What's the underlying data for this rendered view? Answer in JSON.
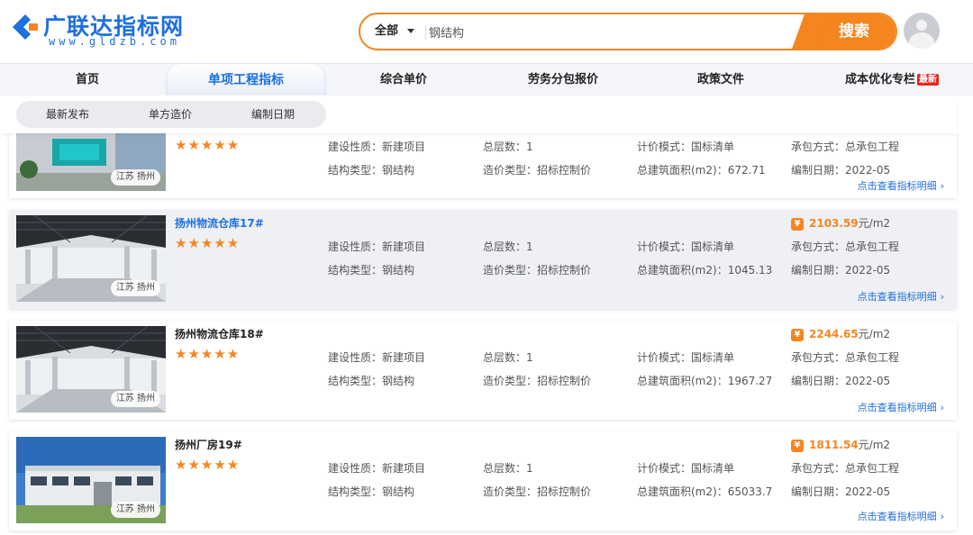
{
  "header": {
    "logo_text": "广联达指标网",
    "logo_sub": "www.gldzb.com",
    "search_scope": "全部",
    "search_value": "钢结构",
    "search_button": "搜索"
  },
  "nav": {
    "items": [
      {
        "label": "首页"
      },
      {
        "label": "单项工程指标"
      },
      {
        "label": "综合单价"
      },
      {
        "label": "劳务分包报价"
      },
      {
        "label": "政策文件"
      },
      {
        "label": "成本优化专栏",
        "badge": "最新"
      }
    ]
  },
  "subnav": {
    "items": [
      {
        "label": "最新发布"
      },
      {
        "label": "单方造价"
      },
      {
        "label": "编制日期"
      }
    ]
  },
  "cards": [
    {
      "title": "",
      "stars": "★★★★★",
      "location": "江苏 扬州",
      "price_amount": "",
      "price_unit": "",
      "nature": "建设性质：新建项目",
      "structure": "结构类型：钢结构",
      "floors": "总层数：1",
      "cost_type": "造价类型：招标控制价",
      "pricing_mode": "计价模式：国标清单",
      "area": "总建筑面积(m2)：672.71",
      "contract": "承包方式：总承包工程",
      "date": "编制日期：2022-05",
      "link": "点击查看指标明细"
    },
    {
      "title": "扬州物流仓库17#",
      "stars": "★★★★★",
      "location": "江苏 扬州",
      "price_amount": "2103.59",
      "price_unit": "元/m2",
      "nature": "建设性质：新建项目",
      "structure": "结构类型：钢结构",
      "floors": "总层数：1",
      "cost_type": "造价类型：招标控制价",
      "pricing_mode": "计价模式：国标清单",
      "area": "总建筑面积(m2)：1045.13",
      "contract": "承包方式：总承包工程",
      "date": "编制日期：2022-05",
      "link": "点击查看指标明细"
    },
    {
      "title": "扬州物流仓库18#",
      "stars": "★★★★★",
      "location": "江苏 扬州",
      "price_amount": "2244.65",
      "price_unit": "元/m2",
      "nature": "建设性质：新建项目",
      "structure": "结构类型：钢结构",
      "floors": "总层数：1",
      "cost_type": "造价类型：招标控制价",
      "pricing_mode": "计价模式：国标清单",
      "area": "总建筑面积(m2)：1967.27",
      "contract": "承包方式：总承包工程",
      "date": "编制日期：2022-05",
      "link": "点击查看指标明细"
    },
    {
      "title": "扬州厂房19#",
      "stars": "★★★★★",
      "location": "江苏 扬州",
      "price_amount": "1811.54",
      "price_unit": "元/m2",
      "nature": "建设性质：新建项目",
      "structure": "结构类型：钢结构",
      "floors": "总层数：1",
      "cost_type": "造价类型：招标控制价",
      "pricing_mode": "计价模式：国标清单",
      "area": "总建筑面积(m2)：65033.7",
      "contract": "承包方式：总承包工程",
      "date": "编制日期：2022-05",
      "link": "点击查看指标明细"
    }
  ],
  "colors": {
    "brand_blue": "#1e6fe0",
    "accent_orange": "#f5851f",
    "badge_red": "#e8221d"
  },
  "icons": [
    "logo-mark-icon",
    "caret-down-icon",
    "avatar-icon",
    "yen-icon",
    "chevron-right-icon",
    "star-icon"
  ]
}
